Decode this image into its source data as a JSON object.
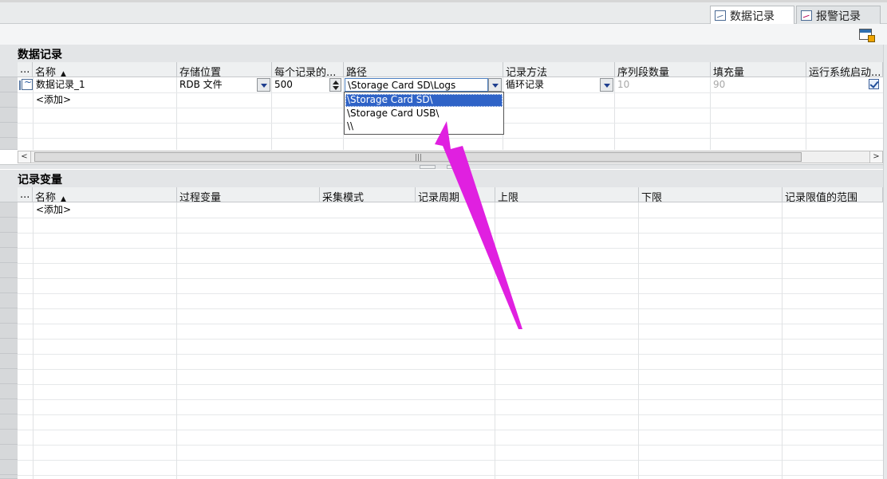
{
  "tabs": [
    {
      "label": "数据记录",
      "icon": "data-log-icon",
      "active": true
    },
    {
      "label": "报警记录",
      "icon": "alarm-log-icon",
      "active": false
    }
  ],
  "data_logs": {
    "title": "数据记录",
    "columns": [
      "...",
      "名称",
      "存储位置",
      "每个记录的...",
      "路径",
      "记录方法",
      "序列段数量",
      "填充量",
      "运行系统启动..."
    ],
    "sort_glyph": "▲",
    "row": {
      "name": "数据记录_1",
      "storage": "RDB 文件",
      "records": "500",
      "path": "\\Storage Card SD\\Logs",
      "method": "循环记录",
      "segments": "10",
      "fill": "90",
      "autostart_checked": true
    },
    "add_row": "<添加>",
    "path_options": [
      "\\Storage Card SD\\",
      "\\Storage Card USB\\",
      "\\\\"
    ],
    "path_selected": 0,
    "scroll_grip": "|||"
  },
  "log_tags": {
    "title": "记录变量",
    "columns": [
      "...",
      "名称",
      "过程变量",
      "采集模式",
      "记录周期",
      "上限",
      "下限",
      "记录限值的范围"
    ],
    "sort_glyph": "▲",
    "add_row": "<添加>"
  },
  "colors": {
    "accent": "#2f63c7",
    "arrow": "#e020e0"
  },
  "icons": [
    "data-log-icon",
    "alarm-log-icon",
    "toolbar-settings-icon",
    "record-icon",
    "dropdown-arrow-icon",
    "spinner-icon",
    "checkbox-icon",
    "scroll-left-icon",
    "scroll-right-icon"
  ]
}
